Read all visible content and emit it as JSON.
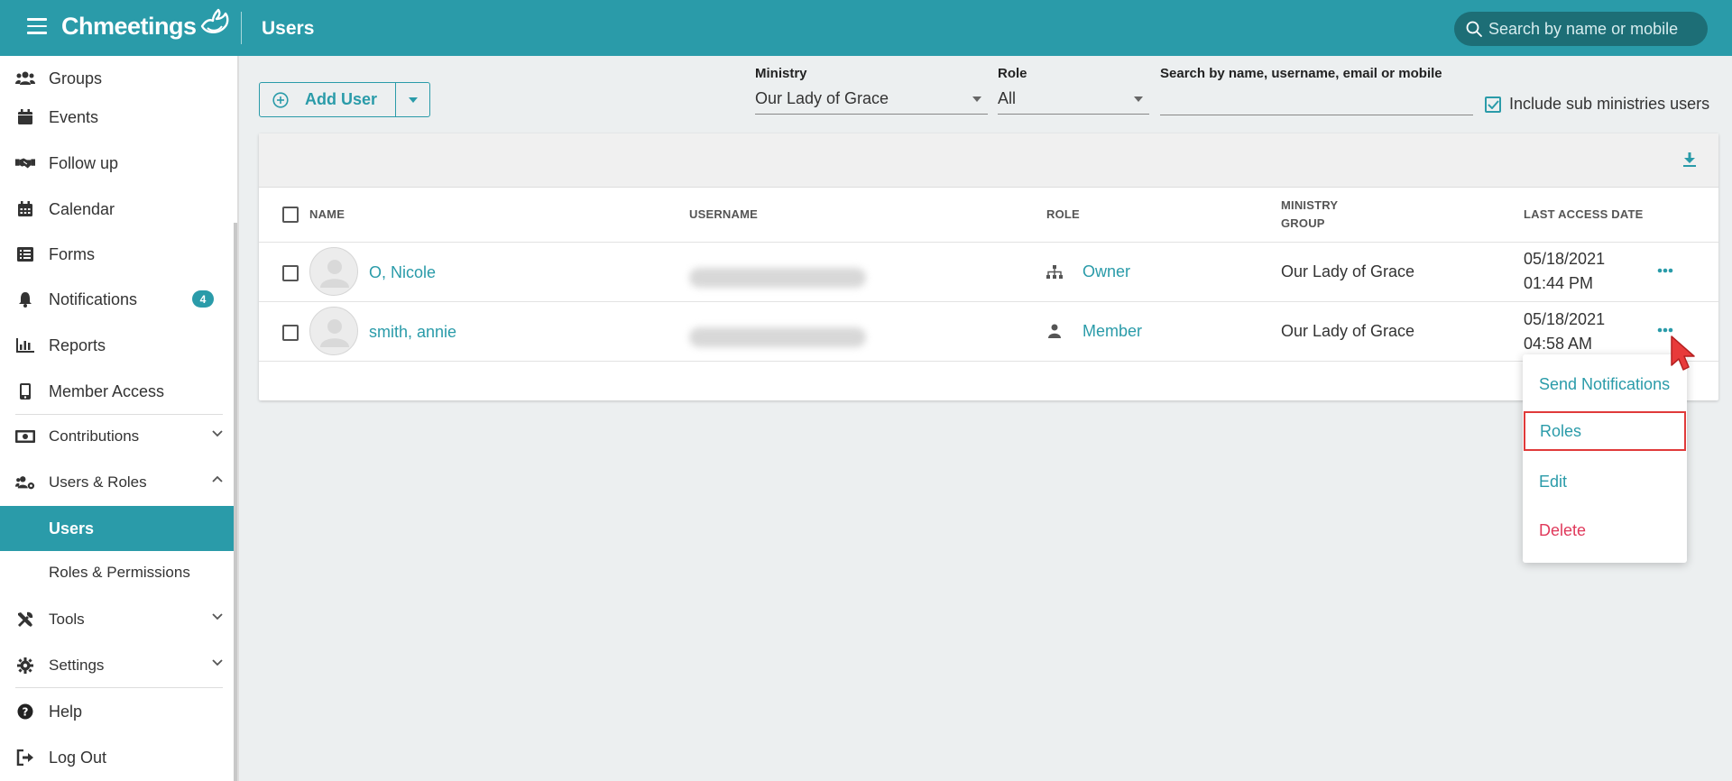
{
  "header": {
    "brand": "Chmeetings",
    "title": "Users",
    "search_placeholder": "Search by name or mobile"
  },
  "sidebar": {
    "items": [
      {
        "label": "Groups",
        "icon": "groups-icon"
      },
      {
        "label": "Events",
        "icon": "events-icon"
      },
      {
        "label": "Follow up",
        "icon": "handshake-icon"
      },
      {
        "label": "Calendar",
        "icon": "calendar-icon"
      },
      {
        "label": "Forms",
        "icon": "forms-icon"
      },
      {
        "label": "Notifications",
        "icon": "bell-icon",
        "badge": "4"
      },
      {
        "label": "Reports",
        "icon": "reports-icon"
      },
      {
        "label": "Member Access",
        "icon": "mobile-icon"
      },
      {
        "label": "Contributions",
        "icon": "money-icon"
      },
      {
        "label": "Users & Roles",
        "icon": "users-cog-icon"
      },
      {
        "label": "Users"
      },
      {
        "label": "Roles & Permissions"
      },
      {
        "label": "Tools",
        "icon": "tools-icon"
      },
      {
        "label": "Settings",
        "icon": "gear-icon"
      },
      {
        "label": "Help",
        "icon": "help-icon"
      },
      {
        "label": "Log Out",
        "icon": "logout-icon"
      }
    ]
  },
  "toolbar": {
    "add_user_label": "Add User",
    "ministry_label": "Ministry",
    "ministry_value": "Our Lady of Grace",
    "role_label": "Role",
    "role_value": "All",
    "search_label": "Search by name, username, email or mobile",
    "search_value": "",
    "include_sub_label": "Include sub ministries users"
  },
  "table": {
    "columns": {
      "name": "NAME",
      "username": "USERNAME",
      "role": "ROLE",
      "ministry_line1": "MINISTRY",
      "ministry_line2": "GROUP",
      "last_access": "LAST ACCESS DATE"
    },
    "rows": [
      {
        "name": "O, Nicole",
        "role": "Owner",
        "role_icon": "hierarchy-icon",
        "ministry": "Our Lady of Grace",
        "date": "05/18/2021",
        "time": "01:44 PM"
      },
      {
        "name": "smith, annie",
        "role": "Member",
        "role_icon": "user-icon",
        "ministry": "Our Lady of Grace",
        "date": "05/18/2021",
        "time": "04:58 AM"
      }
    ]
  },
  "row_menu": {
    "items": [
      "Send Notifications",
      "Roles",
      "Edit",
      "Delete"
    ]
  },
  "colors": {
    "accent": "#2a9ba9",
    "accent_dark": "#1d6e76",
    "danger": "#e0395b",
    "highlight": "#e03a3a"
  }
}
